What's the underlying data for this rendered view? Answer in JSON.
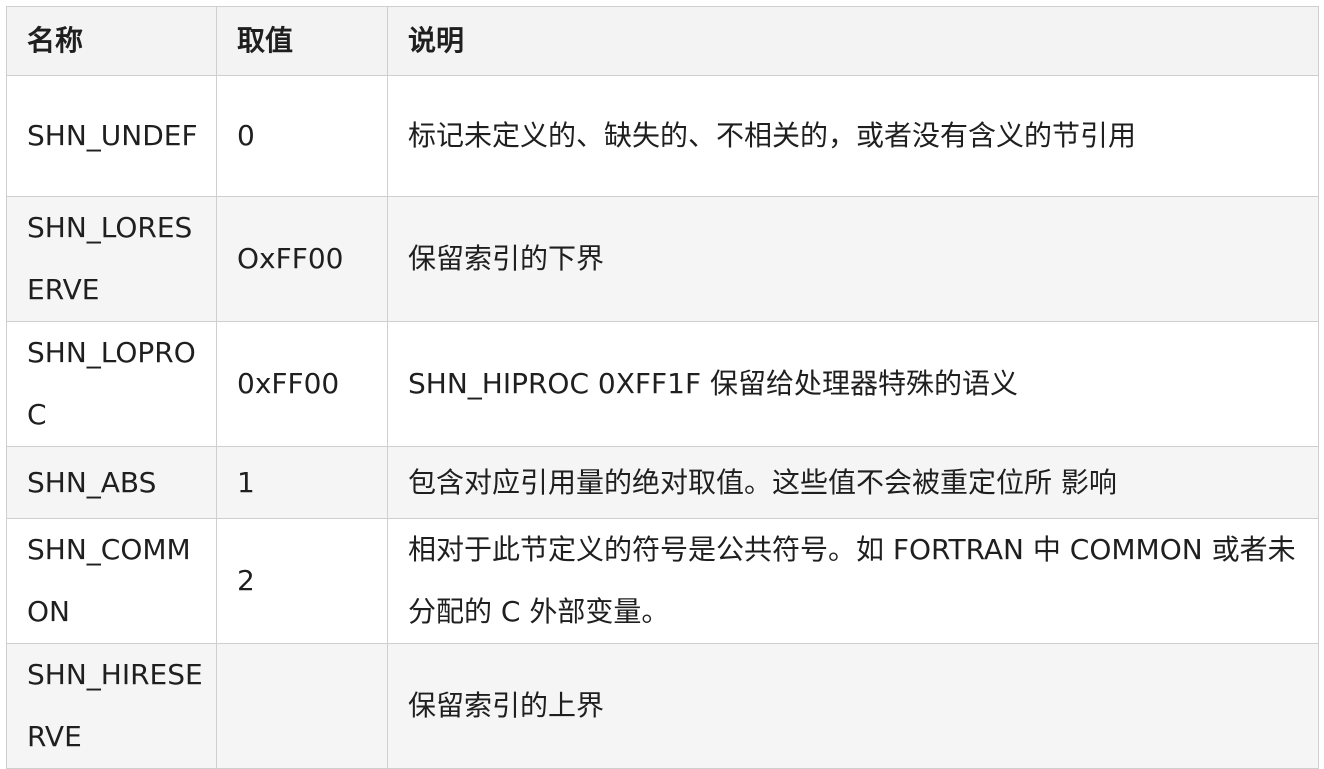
{
  "table": {
    "headers": [
      "名称",
      "取值",
      "说明"
    ],
    "rows": [
      {
        "name": "SHN_UNDEF",
        "value": "0",
        "desc": "标记未定义的、缺失的、不相关的，或者没有含义的节引用"
      },
      {
        "name": "SHN_LORESERVE",
        "value": "OxFF00",
        "desc": "保留索引的下界"
      },
      {
        "name": "SHN_LOPROC",
        "value": "0xFF00",
        "desc": "SHN_HIPROC 0XFF1F 保留给处理器特殊的语义"
      },
      {
        "name": "SHN_ABS",
        "value": "1",
        "desc": "包含对应引用量的绝对取值。这些值不会被重定位所 影响"
      },
      {
        "name": "SHN_COMMON",
        "value": "2",
        "desc": "相对于此节定义的符号是公共符号。如 FORTRAN 中 COMMON 或者未分配的 C 外部变量。"
      },
      {
        "name": "SHN_HIRESERVE",
        "value": "",
        "desc": "保留索引的上界"
      }
    ]
  }
}
